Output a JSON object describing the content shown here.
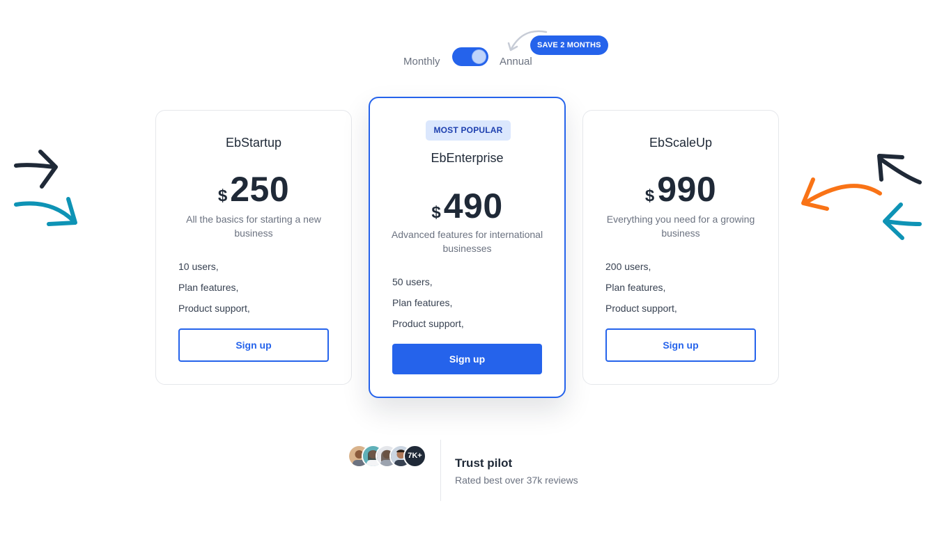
{
  "billing": {
    "monthly_label": "Monthly",
    "annual_label": "Annual",
    "toggle_state": "annual",
    "save_badge": "SAVE 2 MONTHS"
  },
  "plans": [
    {
      "name": "EbStartup",
      "currency": "$",
      "price": "250",
      "description": "All the basics for starting a new business",
      "features": [
        "10 users,",
        "Plan features,",
        "Product support,"
      ],
      "cta": "Sign up"
    },
    {
      "badge": "MOST POPULAR",
      "name": "EbEnterprise",
      "currency": "$",
      "price": "490",
      "description": "Advanced features for international businesses",
      "features": [
        "50 users,",
        "Plan features,",
        "Product support,"
      ],
      "cta": "Sign up"
    },
    {
      "name": "EbScaleUp",
      "currency": "$",
      "price": "990",
      "description": "Everything you need for a growing business",
      "features": [
        "200 users,",
        "Plan features,",
        "Product support,"
      ],
      "cta": "Sign up"
    }
  ],
  "trust": {
    "count_badge": "7K+",
    "title": "Trust pilot",
    "subtitle": "Rated best over 37k reviews"
  },
  "colors": {
    "accent": "#2563eb",
    "dark": "#1f2937",
    "teal": "#0e93b5",
    "orange": "#f97316",
    "badge_bg": "#dbe7fd"
  },
  "icons": {
    "left_arrows": [
      "arrow-right-icon",
      "curved-arrow-right-icon"
    ],
    "right_arrows": [
      "curved-arrow-up-left-icon",
      "curved-arrow-left-icon",
      "arrow-left-icon"
    ],
    "save_pointer": "curved-arrow-icon"
  }
}
